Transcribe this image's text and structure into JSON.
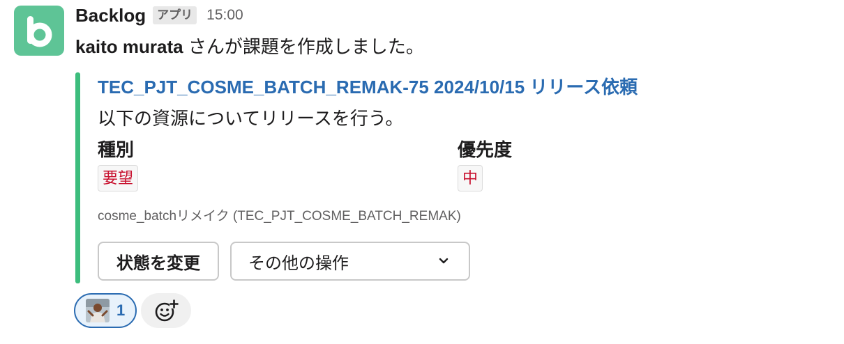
{
  "header": {
    "sender": "Backlog",
    "app_badge": "アプリ",
    "time": "15:00"
  },
  "message": {
    "actor": "kaito murata",
    "text": " さんが課題を作成しました。"
  },
  "issue": {
    "title": "TEC_PJT_COSME_BATCH_REMAK-75 2024/10/15 リリース依頼",
    "description": "以下の資源についてリリースを行う。",
    "fields": [
      {
        "label": "種別",
        "value": "要望"
      },
      {
        "label": "優先度",
        "value": "中"
      }
    ],
    "project": "cosme_batchリメイク (TEC_PJT_COSME_BATCH_REMAK)"
  },
  "actions": {
    "change_status": "状態を変更",
    "other_ops": "その他の操作"
  },
  "reactions": {
    "count": "1"
  },
  "icons": {
    "app": "backlog-logo-icon",
    "chevron": "chevron-down-icon",
    "add_reaction": "add-reaction-icon"
  },
  "colors": {
    "accent_bar": "#3dbd7d",
    "link": "#2a6bb1",
    "field_value": "#c8102e",
    "app_icon_bg": "#5ec496"
  }
}
